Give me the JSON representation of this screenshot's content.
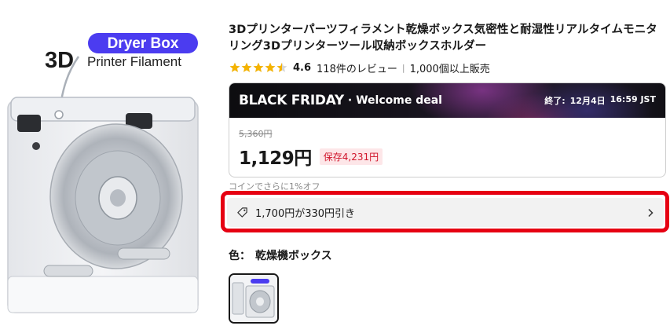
{
  "product": {
    "image": {
      "brand_line1": "Dryer Box",
      "brand_3d": "3D",
      "brand_line2": "Printer Filament"
    },
    "title": "3Dプリンターパーツフィラメント乾燥ボックス気密性と耐湿性リアルタイムモニタリング3Dプリンターツール収納ボックスホルダー",
    "rating": {
      "value": "4.6",
      "reviews": "118件のレビュー",
      "separator": "|",
      "sold": "1,000個以上販売",
      "stars_filled": 4.5
    }
  },
  "deal": {
    "black_friday": "BLACK FRIDAY",
    "welcome": "· Welcome deal",
    "end_label": "終了:",
    "end_date": "12月4日",
    "end_time": "16:59 JST",
    "original_price": "5,360円",
    "current_price": "1,129円",
    "savings": "保存4,231円"
  },
  "coin_note": "コインでさらに1%オフ",
  "coupon": {
    "text": "1,700円が330円引き",
    "icon": "tag-icon",
    "chevron": "chevron-right-icon"
  },
  "color": {
    "label": "色：",
    "value": "乾燥機ボックス"
  },
  "colors": {
    "accent": "#e60012",
    "savings_text": "#d0152b",
    "savings_bg": "#fde6e8",
    "star": "#f5b301"
  }
}
